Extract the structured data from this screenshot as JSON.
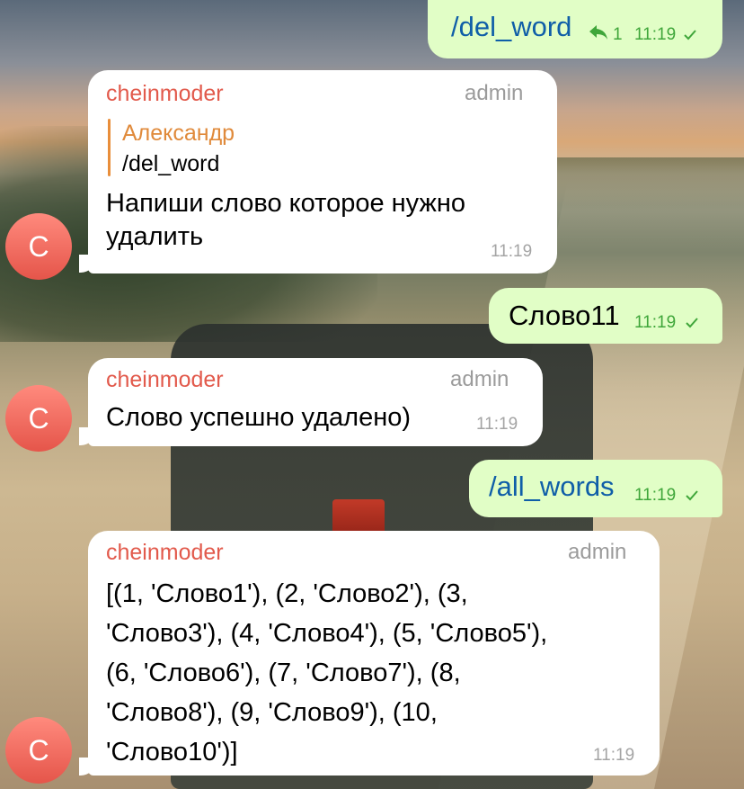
{
  "messages": [
    {
      "type": "outgoing",
      "text": "/del_word",
      "replies": "1",
      "time": "11:19"
    },
    {
      "type": "incoming",
      "sender": "cheinmoder",
      "role": "admin",
      "reply_to": {
        "name": "Александр",
        "text": "/del_word"
      },
      "lines": [
        "Напиши слово которое нужно",
        "удалить"
      ],
      "time": "11:19"
    },
    {
      "type": "outgoing",
      "text": "Слово11",
      "time": "11:19"
    },
    {
      "type": "incoming",
      "sender": "cheinmoder",
      "role": "admin",
      "lines": [
        "Слово успешно удалено)"
      ],
      "time": "11:19"
    },
    {
      "type": "outgoing",
      "text": "/all_words",
      "time": "11:19"
    },
    {
      "type": "incoming",
      "sender": "cheinmoder",
      "role": "admin",
      "lines": [
        "[(1, 'Слово1'), (2, 'Слово2'), (3,",
        "'Слово3'), (4, 'Слово4'), (5, 'Слово5'),",
        "(6, 'Слово6'), (7, 'Слово7'), (8,",
        "'Слово8'), (9, 'Слово9'), (10,",
        "'Слово10')]"
      ],
      "time": "11:19"
    }
  ],
  "avatar_letter": "C",
  "colors": {
    "outgoing_bubble": "#e1fec6",
    "incoming_bubble": "#ffffff",
    "sender": "#e25a4c",
    "link": "#0f5ea8",
    "check": "#3fa63a",
    "quote": "#e98e3b"
  }
}
